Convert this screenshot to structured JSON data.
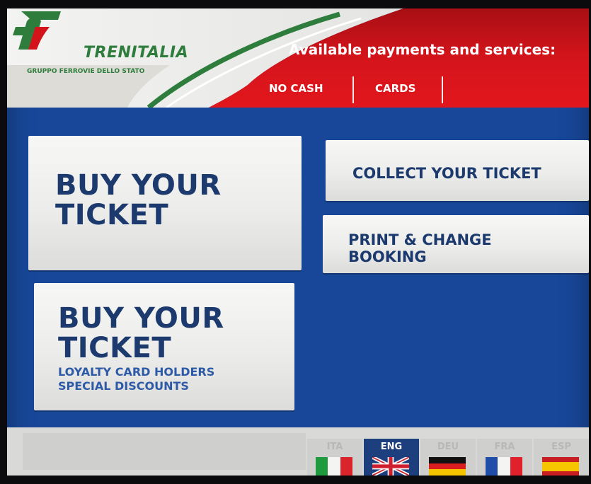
{
  "header": {
    "brand_name": "TRENITALIA",
    "brand_subtitle": "GRUPPO FERROVIE DELLO STATO",
    "payments_title": "Available payments and services:",
    "payment_options": [
      "NO CASH",
      "CARDS"
    ]
  },
  "buttons": {
    "buy_ticket": {
      "line1": "BUY YOUR",
      "line2": "TICKET"
    },
    "collect_ticket": {
      "label": "COLLECT YOUR TICKET"
    },
    "print_change": {
      "line1": "PRINT & CHANGE",
      "line2": "BOOKING"
    },
    "buy_ticket_loyalty": {
      "line1": "BUY YOUR",
      "line2": "TICKET",
      "sub1": "LOYALTY CARD HOLDERS",
      "sub2": "SPECIAL DISCOUNTS"
    }
  },
  "languages": [
    {
      "code": "ITA",
      "flag": "italy-flag",
      "active": false
    },
    {
      "code": "ENG",
      "flag": "uk-flag",
      "active": true
    },
    {
      "code": "DEU",
      "flag": "germany-flag",
      "active": false
    },
    {
      "code": "FRA",
      "flag": "france-flag",
      "active": false
    },
    {
      "code": "ESP",
      "flag": "spain-flag",
      "active": false
    }
  ],
  "colors": {
    "brand_green": "#2e7d3c",
    "brand_red": "#d4141b",
    "screen_blue": "#18479a",
    "button_text": "#1c3a6e"
  }
}
